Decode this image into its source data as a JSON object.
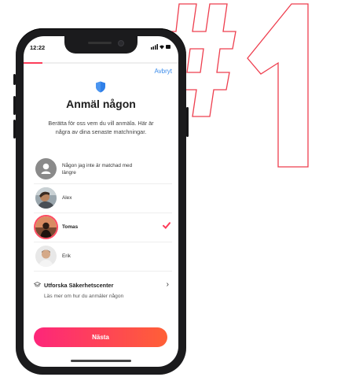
{
  "status_bar": {
    "time": "12:22",
    "icons": "▮▮▮ ◔ ▬"
  },
  "colors": {
    "accent": "#fd3d5a",
    "link": "#3b8ceb",
    "shield": "#2f7fe8",
    "button_start": "#fd267a",
    "button_end": "#ff6036",
    "graphic_stroke": "#ee3e4e"
  },
  "progress": 0.12,
  "header": {
    "cancel_label": "Avbryt"
  },
  "screen": {
    "title": "Anmäl någon",
    "description": "Berätta för oss vem du vill anmäla. Här är några av dina senaste matchningar."
  },
  "matches": [
    {
      "label": "Någon jag inte är matchad med längre",
      "avatar": "unknown-person-icon",
      "selected": false
    },
    {
      "label": "Alex",
      "avatar": "photo",
      "selected": false
    },
    {
      "label": "Tomas",
      "avatar": "photo",
      "selected": true
    },
    {
      "label": "Erik",
      "avatar": "photo",
      "selected": false
    }
  ],
  "safety": {
    "title": "Utforska Säkerhetscenter",
    "subtitle": "Läs mer om hur du anmäler någon"
  },
  "footer": {
    "next_label": "Nästa"
  },
  "background_graphic": {
    "text": "#1"
  }
}
